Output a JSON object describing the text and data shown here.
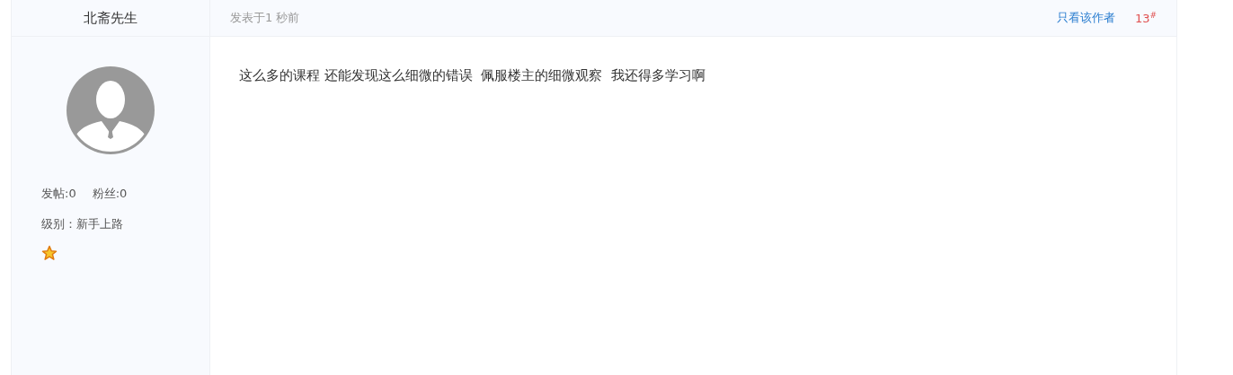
{
  "author": {
    "name": "北斋先生",
    "posts": "发帖:0",
    "fans": "粉丝:0",
    "level": "级别：新手上路"
  },
  "post": {
    "time": "发表于1 秒前",
    "only_author": "只看该作者",
    "floor": "13$^{#}$",
    "content": "这么多的课程 还能发现这么细微的错误  佩服楼主的细微观察  我还得多学习啊"
  }
}
